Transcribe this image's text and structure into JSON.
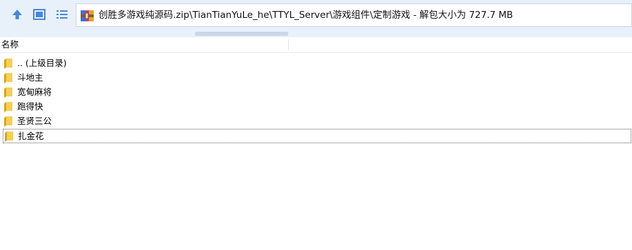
{
  "toolbar": {
    "buttons": [
      {
        "icon": "up-arrow-icon"
      },
      {
        "icon": "thumbnail-view-icon"
      },
      {
        "icon": "details-view-icon"
      }
    ]
  },
  "address": {
    "archive_icon": "winrar-archive-icon",
    "path": "创胜多游戏纯源码.zip\\TianTianYuLe_he\\TTYL_Server\\游戏组件\\定制游戏 - 解包大小为 727.7 MB"
  },
  "columns": {
    "name": "名称"
  },
  "files": [
    {
      "name": ".. (上级目录)",
      "icon": "folder-icon"
    },
    {
      "name": "斗地主",
      "icon": "folder-icon"
    },
    {
      "name": "宽甸麻将",
      "icon": "folder-icon"
    },
    {
      "name": "跑得快",
      "icon": "folder-icon"
    },
    {
      "name": "圣贤三公",
      "icon": "folder-icon"
    },
    {
      "name": "扎金花",
      "icon": "folder-icon",
      "focused": true
    }
  ],
  "colors": {
    "toolbar_bg": "#e8f0fa",
    "icon_blue": "#3a7bd5",
    "folder_yellow": "#f5c842"
  }
}
